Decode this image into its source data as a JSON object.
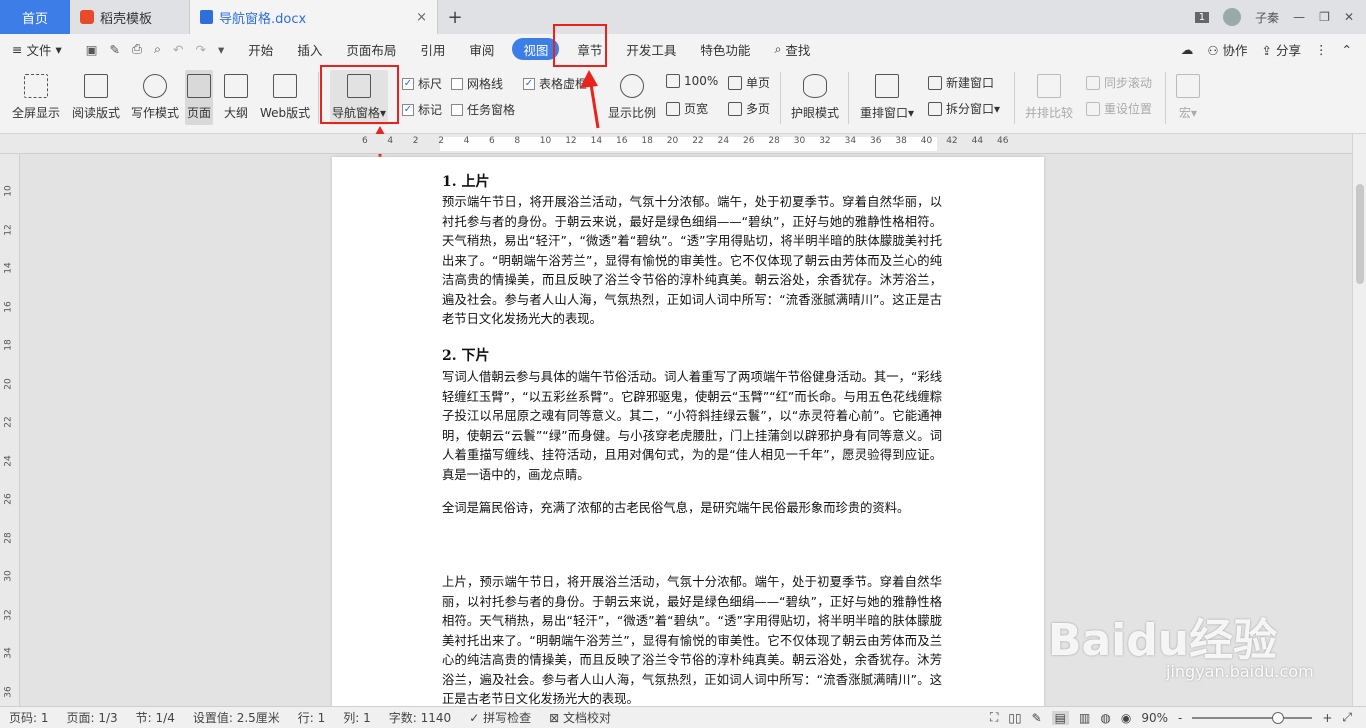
{
  "tabs": {
    "home": "首页",
    "template": "稻壳模板",
    "doc": "导航窗格.docx",
    "close": "×",
    "new": "+"
  },
  "window": {
    "page_badge": "1",
    "user": "子秦"
  },
  "menu": {
    "file": "文件",
    "items": [
      "开始",
      "插入",
      "页面布局",
      "引用",
      "审阅",
      "视图",
      "章节",
      "开发工具",
      "特色功能",
      "查找"
    ],
    "right": [
      "协作",
      "分享"
    ]
  },
  "ribbon": {
    "fullscreen": "全屏显示",
    "reading": "阅读版式",
    "writing": "写作模式",
    "page": "页面",
    "outline": "大纲",
    "web": "Web版式",
    "nav": "导航窗格",
    "ruler": "标尺",
    "grid": "网格线",
    "table_border": "表格虚框",
    "mark": "标记",
    "task_pane": "任务窗格",
    "zoom": "显示比例",
    "zoom_100": "100%",
    "single": "单页",
    "page_width": "页宽",
    "multi": "多页",
    "eye": "护眼模式",
    "rearrange": "重排窗口",
    "new_window": "新建窗口",
    "split": "拆分窗口",
    "side_by_side": "并排比较",
    "sync_scroll": "同步滚动",
    "reset_pos": "重设位置",
    "macro": "宏"
  },
  "ruler": {
    "h": [
      "6",
      "4",
      "2",
      "2",
      "4",
      "6",
      "8",
      "10",
      "12",
      "14",
      "16",
      "18",
      "20",
      "22",
      "24",
      "26",
      "28",
      "30",
      "32",
      "34",
      "36",
      "38",
      "40",
      "42",
      "44",
      "46"
    ],
    "v": [
      "10",
      "12",
      "14",
      "16",
      "18",
      "20",
      "22",
      "24",
      "26",
      "28",
      "30",
      "32",
      "34",
      "36"
    ]
  },
  "document": {
    "h1": "1. 上片",
    "p1": "预示端午节日，将开展浴兰活动，气氛十分浓郁。端午，处于初夏季节。穿着自然华丽，以衬托参与者的身份。于朝云来说，最好是绿色细绢——“碧纨”，正好与她的雅静性格相符。天气稍热，易出“轻汗”，“微透”着“碧纨”。“透”字用得贴切，将半明半暗的肤体朦胧美衬托出来了。“明朝端午浴芳兰”，显得有愉悦的审美性。它不仅体现了朝云由芳体而及兰心的纯洁高贵的情操美，而且反映了浴兰令节俗的淳朴纯真美。朝云浴处，余香犹存。沐芳浴兰，遍及社会。参与者人山人海，气氛热烈，正如词人词中所写：“流香涨腻满晴川”。这正是古老节日文化发扬光大的表现。",
    "h2": "2. 下片",
    "p2": "写词人借朝云参与具体的端午节俗活动。词人着重写了两项端午节俗健身活动。其一，“彩线轻缠红玉臂”，“以五彩丝系臂”。它辟邪驱鬼，使朝云“玉臂”“红”而长命。与用五色花线缠粽子投江以吊屈原之魂有同等意义。其二，“小符斜挂绿云鬟”，以“赤灵符着心前”。它能通神明，使朝云“云鬟”“绿”而身健。与小孩穿老虎腰肚，门上挂蒲剑以辟邪护身有同等意义。词人着重描写缠线、挂符活动，且用对偶句式，为的是“佳人相见一千年”，愿灵验得到应证。真是一语中的，画龙点睛。",
    "p3": "全词是篇民俗诗，充满了浓郁的古老民俗气息，是研究端午民俗最形象而珍贵的资料。",
    "p4": "上片，预示端午节日，将开展浴兰活动，气氛十分浓郁。端午，处于初夏季节。穿着自然华丽，以衬托参与者的身份。于朝云来说，最好是绿色细绢——“碧纨”，正好与她的雅静性格相符。天气稍热，易出“轻汗”，“微透”着“碧纨”。“透”字用得贴切，将半明半暗的肤体朦胧美衬托出来了。“明朝端午浴芳兰”，显得有愉悦的审美性。它不仅体现了朝云由芳体而及兰心的纯洁高贵的情操美，而且反映了浴兰令节俗的淳朴纯真美。朝云浴处，余香犹存。沐芳浴兰，遍及社会。参与者人山人海，气氛热烈，正如词人词中所写：“流香涨腻满晴川”。这正是古老节日文化发扬光大的表现。"
  },
  "status": {
    "page": "页码: 1",
    "pages": "页面: 1/3",
    "section": "节: 1/4",
    "setting": "设置值: 2.5厘米",
    "row": "行: 1",
    "col": "列: 1",
    "words": "字数: 1140",
    "spell": "拼写检查",
    "proof": "文档校对",
    "zoom": "90%",
    "minus": "-",
    "plus": "+"
  },
  "watermark": {
    "brand": "Baidu经验",
    "url": "jingyan.baidu.com"
  },
  "colors": {
    "accent": "#3c7de8",
    "annotation": "#e8231e"
  }
}
